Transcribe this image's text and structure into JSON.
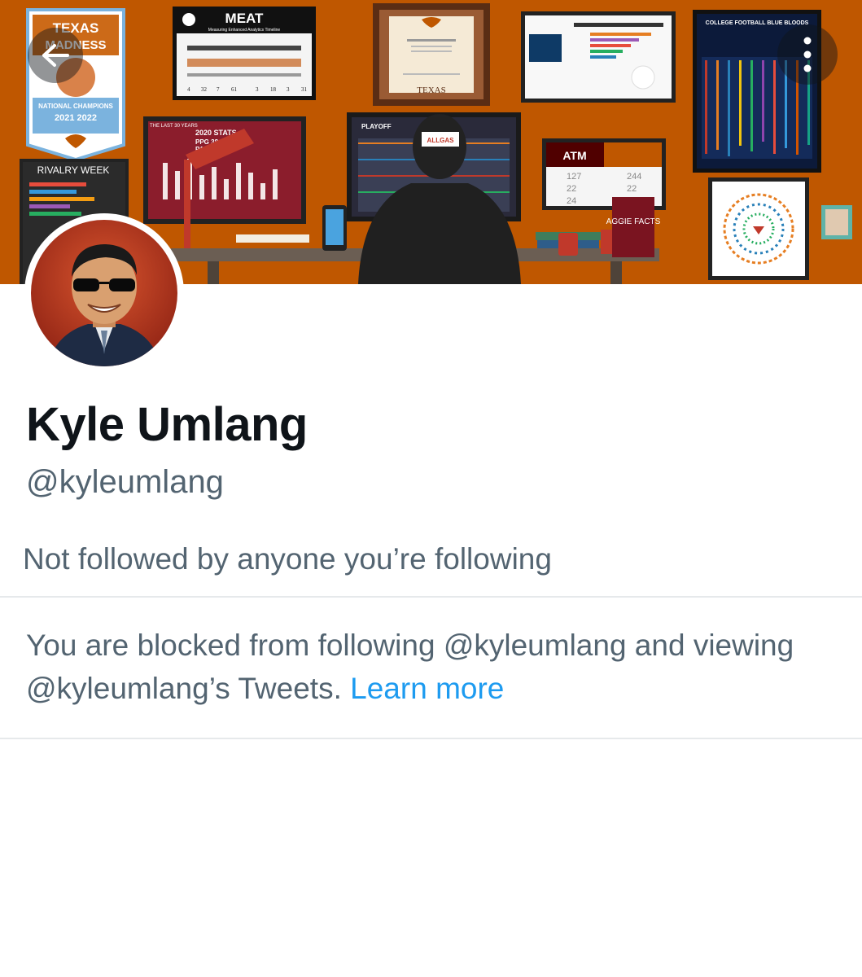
{
  "profile": {
    "display_name": "Kyle Umlang",
    "handle": "@kyleumlang",
    "followers_note": "Not followed by anyone you’re following"
  },
  "blocked": {
    "message": "You are blocked from following @kyleumlang and viewing @kyleumlang’s Tweets.",
    "learn_more": "Learn more"
  },
  "icons": {
    "back": "arrow-left-icon",
    "more": "more-vertical-icon"
  },
  "banner": {
    "pennant_title_1": "TEXAS",
    "pennant_title_2": "MADNESS",
    "pennant_subtitle": "NATIONAL CHAMPIONS",
    "pennant_years": "2021 2022",
    "meat_title": "MEAT",
    "meat_subtitle": "Measuring Enhanced Analytics Timeline",
    "meat_numbers": [
      "4",
      "32",
      "7",
      "61",
      "3",
      "18",
      "3",
      "31"
    ],
    "diploma_title": "TEXAS",
    "rivalry_label": "RIVALRY WEEK",
    "stats_header": "THE LAST 30 YEARS",
    "stats_title": "2020 STATS",
    "stats_line_1": "PPG 38",
    "stats_line_2": "PAPG 23",
    "cfp_label": "PLAYOFF",
    "atm_label": "ATM",
    "atm_scores": [
      "127",
      "22",
      "24",
      "244",
      "22"
    ],
    "aggie_book": "AGGIE FACTS",
    "blue_bloods_title": "COLLEGE FOOTBALL BLUE BLOODS",
    "cap_text": "ALLGAS"
  },
  "colors": {
    "burnt_orange": "#bf5700",
    "link_blue": "#1d9bf0",
    "secondary_text": "#536471",
    "primary_text": "#0f1419"
  }
}
